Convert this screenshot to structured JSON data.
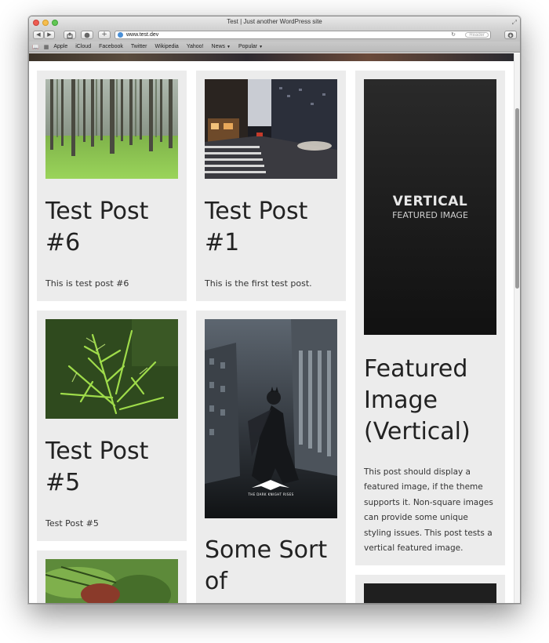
{
  "browser": {
    "window_title": "Test | Just another WordPress site",
    "url": "www.test.dev",
    "reader_label": "Reader",
    "bookmarks": [
      "Apple",
      "iCloud",
      "Facebook",
      "Twitter",
      "Wikipedia",
      "Yahoo!",
      "News",
      "Popular"
    ]
  },
  "posts": [
    {
      "title": "Test Post #6",
      "excerpt": "This is test post #6",
      "image": "forest"
    },
    {
      "title": "Test Post #1",
      "excerpt": "This is the first test post.",
      "image": "city-street"
    },
    {
      "title": "Featured Image (Vertical)",
      "excerpt": "This post should display a featured image, if the theme supports it. Non-square images can provide some unique styling issues. This post tests a vertical featured image.",
      "image": "vertical-featured",
      "image_text": {
        "line1": "VERTICAL",
        "line2": "FEATURED IMAGE"
      }
    },
    {
      "title": "Test Post #5",
      "excerpt": "Test Post #5",
      "image": "fern-leaves"
    },
    {
      "title": "Some Sort of",
      "excerpt": "",
      "image": "dark-knight-poster",
      "image_text": {
        "caption": "THE DARK KNIGHT RISES"
      }
    },
    {
      "title": "",
      "excerpt": "",
      "image": "green-plant"
    },
    {
      "title": "",
      "excerpt": "",
      "image": "dark-image"
    }
  ],
  "colors": {
    "card_bg": "#ececec",
    "text": "#222222"
  }
}
